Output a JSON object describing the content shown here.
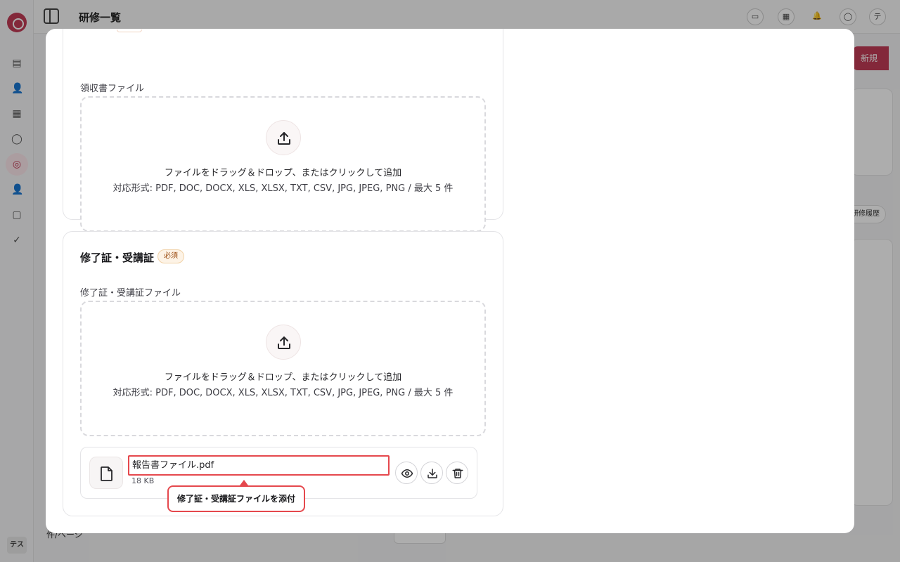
{
  "app": {
    "page_title": "研修一覧",
    "user_initial": "テ",
    "bottom_avatar": "テス",
    "new_button_label": "新規",
    "bg_pill_label": "研修履歴",
    "bg_foot_label": "件/ページ"
  },
  "receipt_section": {
    "field_label": "領収書ファイル",
    "dropzone": {
      "main_text": "ファイルをドラッグ＆ドロップ、またはクリックして追加",
      "formats_text": "対応形式: PDF, DOC, DOCX, XLS, XLSX, TXT, CSV, JPG, JPEG, PNG / 最大 5 件"
    }
  },
  "certificate_section": {
    "title": "修了証・受講証",
    "required_label": "必須",
    "field_label": "修了証・受講証ファイル",
    "dropzone": {
      "main_text": "ファイルをドラッグ＆ドロップ、またはクリックして追加",
      "formats_text": "対応形式: PDF, DOC, DOCX, XLS, XLSX, TXT, CSV, JPG, JPEG, PNG / 最大 5 件"
    },
    "attached_file": {
      "name": "報告書ファイル.pdf",
      "size": "18 KB",
      "icons": [
        "file-icon",
        "eye-icon",
        "download-icon",
        "trash-icon"
      ]
    }
  },
  "tooltip": {
    "text": "修了証・受講証ファイルを添付"
  },
  "colors": {
    "highlight": "#e5484d",
    "brand": "#c23b56",
    "required_badge_bg": "#fdf3e6",
    "required_badge_text": "#9a4a0f"
  }
}
